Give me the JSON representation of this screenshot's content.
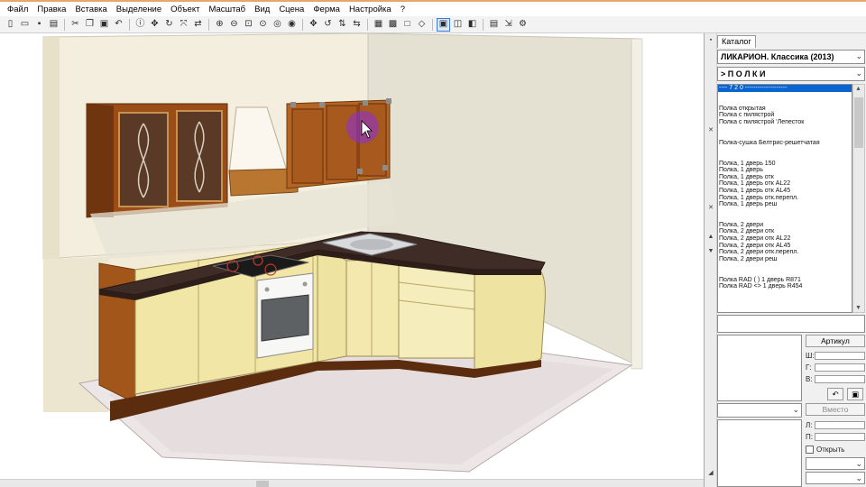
{
  "menu": [
    "Файл",
    "Правка",
    "Вставка",
    "Выделение",
    "Объект",
    "Масштаб",
    "Вид",
    "Сцена",
    "Ферма",
    "Настройка",
    "?"
  ],
  "toolbar": {
    "groups": [
      [
        {
          "icon": "new-file-icon",
          "glyph": "▯"
        },
        {
          "icon": "open-folder-icon",
          "glyph": "▭"
        },
        {
          "icon": "save-icon",
          "glyph": "▪"
        },
        {
          "icon": "print-icon",
          "glyph": "▤"
        }
      ],
      [
        {
          "icon": "cut-icon",
          "glyph": "✂"
        },
        {
          "icon": "copy-icon",
          "glyph": "❐"
        },
        {
          "icon": "paste-icon",
          "glyph": "▣"
        },
        {
          "icon": "undo-icon",
          "glyph": "↶"
        }
      ],
      [
        {
          "icon": "info-icon",
          "glyph": "ⓘ"
        },
        {
          "icon": "move-icon",
          "glyph": "✥"
        },
        {
          "icon": "rotate-icon",
          "glyph": "↻"
        },
        {
          "icon": "scale-icon",
          "glyph": "⤧"
        },
        {
          "icon": "mirror-icon",
          "glyph": "⇄"
        }
      ],
      [
        {
          "icon": "zoom-in-icon",
          "glyph": "⊕"
        },
        {
          "icon": "zoom-out-icon",
          "glyph": "⊖"
        },
        {
          "icon": "zoom-window-icon",
          "glyph": "⊡"
        },
        {
          "icon": "zoom-all-icon",
          "glyph": "⊙"
        },
        {
          "icon": "zoom-previous-icon",
          "glyph": "◎"
        },
        {
          "icon": "zoom-selection-icon",
          "glyph": "◉"
        }
      ],
      [
        {
          "icon": "pan-icon",
          "glyph": "✥"
        },
        {
          "icon": "orbit-icon",
          "glyph": "↺"
        },
        {
          "icon": "walk-icon",
          "glyph": "⇅"
        },
        {
          "icon": "look-icon",
          "glyph": "⇆"
        }
      ],
      [
        {
          "icon": "camera-icon",
          "glyph": "▦"
        },
        {
          "icon": "render-icon",
          "glyph": "▩"
        },
        {
          "icon": "frame-icon",
          "glyph": "□"
        },
        {
          "icon": "light-icon",
          "glyph": "◇"
        }
      ],
      [
        {
          "icon": "view-3d-icon",
          "glyph": "▣",
          "active": true
        },
        {
          "icon": "view-wire-icon",
          "glyph": "◫"
        },
        {
          "icon": "view-shade-icon",
          "glyph": "◧"
        }
      ],
      [
        {
          "icon": "report-icon",
          "glyph": "▤"
        },
        {
          "icon": "export-icon",
          "glyph": "⇲"
        },
        {
          "icon": "settings-icon",
          "glyph": "⚙"
        }
      ]
    ]
  },
  "panel": {
    "tab": "Каталог",
    "catalog_select": "ЛИКАРИОН. Классика (2013)",
    "section_select": "> П О Л К И",
    "list": [
      {
        "text": "---- 7 2 0 --------------------",
        "selected": true
      },
      {
        "text": ""
      },
      {
        "text": ""
      },
      {
        "text": "Полка открытая"
      },
      {
        "text": "Полка с пилястрой"
      },
      {
        "text": "Полка с пилястрой 'Лепесток"
      },
      {
        "text": ""
      },
      {
        "text": ""
      },
      {
        "text": "Полка-сушка Белтрис-решетчатая"
      },
      {
        "text": ""
      },
      {
        "text": ""
      },
      {
        "text": "Полка, 1 дверь 150"
      },
      {
        "text": "Полка, 1 дверь"
      },
      {
        "text": "Полка, 1 дверь отк"
      },
      {
        "text": "Полка, 1 дверь отк AL22"
      },
      {
        "text": "Полка, 1 дверь отк AL45"
      },
      {
        "text": "Полка, 1 дверь отк.перепл."
      },
      {
        "text": "Полка, 1 дверь реш"
      },
      {
        "text": ""
      },
      {
        "text": ""
      },
      {
        "text": "Полка, 2 двери"
      },
      {
        "text": "Полка, 2 двери отк"
      },
      {
        "text": "Полка, 2 двери отк AL22"
      },
      {
        "text": "Полка, 2 двери отк AL45"
      },
      {
        "text": "Полка, 2 двери отк.перепл."
      },
      {
        "text": "Полка, 2 двери реш"
      },
      {
        "text": ""
      },
      {
        "text": ""
      },
      {
        "text": "Полка RAD ( ) 1 дверь R871"
      },
      {
        "text": "Полка RAD <> 1 дверь R454"
      }
    ],
    "article_button": "Артикул",
    "field_labels": [
      "Ш:",
      "Г:",
      "В:"
    ],
    "insert_button": "Вместо",
    "field_labels_2": [
      "Л:",
      "П:"
    ],
    "open_checkbox": "Открыть"
  },
  "colors": {
    "accent_border": "#e3a86a",
    "selection": "#0a64d2",
    "wall_left": "#f3eedd",
    "wall_right": "#e4e1d3",
    "cabinet_front": "#f1e6a6",
    "countertop": "#3f2c26",
    "upper_wood": "#9a4d17",
    "cursor_highlight": "#8a2be2"
  }
}
